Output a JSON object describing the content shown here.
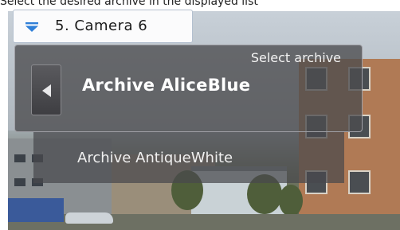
{
  "instruction": "Select the desired archive in the displayed list",
  "camera_select": {
    "label": "5. Camera 6",
    "icon": "triangle-down-icon",
    "accent": "#2f7fd8"
  },
  "archive_panel": {
    "title": "Select archive",
    "back_icon": "triangle-left-icon",
    "current": "Archive AliceBlue",
    "items": [
      "Archive AntiqueWhite"
    ]
  }
}
